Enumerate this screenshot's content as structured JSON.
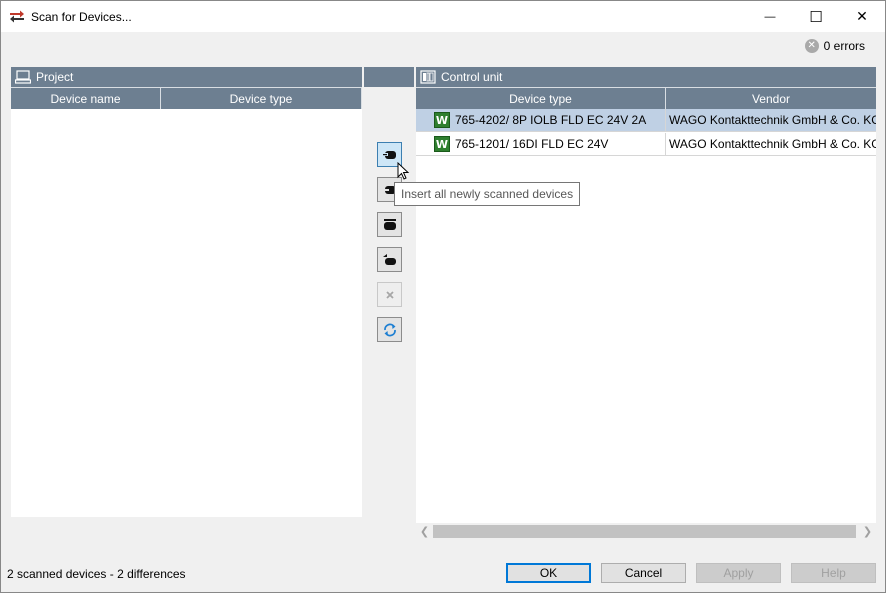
{
  "window": {
    "title": "Scan for Devices...",
    "minimize_glyph": "—",
    "maximize_glyph": "☐",
    "close_glyph": "✕"
  },
  "errors": {
    "icon": "error-circle-icon",
    "label": "0 errors"
  },
  "project_panel": {
    "title": "Project",
    "icon": "computer-icon",
    "columns": [
      "Device name",
      "Device type"
    ]
  },
  "control_panel": {
    "title": "Control unit",
    "icon": "control-unit-icon",
    "columns": [
      "Device type",
      "Vendor"
    ],
    "rows": [
      {
        "device_type": "765-4202/ 8P IOLB FLD EC 24V 2A",
        "vendor": "WAGO Kontakttechnik GmbH & Co. KG",
        "icon": "wago-icon",
        "selected": true
      },
      {
        "device_type": "765-1201/ 16DI FLD EC 24V",
        "vendor": "WAGO Kontakttechnik GmbH & Co. KG",
        "icon": "wago-icon",
        "selected": false
      }
    ]
  },
  "toolbar": {
    "buttons": [
      {
        "name": "insert-all-new-button",
        "icon": "insert-all-icon",
        "active": true
      },
      {
        "name": "insert-selected-button",
        "icon": "insert-icon"
      },
      {
        "name": "copy-all-button",
        "icon": "copy-all-icon"
      },
      {
        "name": "replace-button",
        "icon": "replace-icon"
      },
      {
        "name": "delete-button",
        "icon": "delete-icon",
        "disabled": true
      },
      {
        "name": "refresh-button",
        "icon": "refresh-icon"
      }
    ],
    "tooltip": "Insert all newly scanned devices"
  },
  "wago_glyph": "W",
  "status": "2 scanned devices - 2 differences",
  "buttons": {
    "ok": "OK",
    "cancel": "Cancel",
    "apply": "Apply",
    "help": "Help"
  },
  "colors": {
    "header_bg": "#6d7f91",
    "selected_row": "#bfd0e4",
    "wago_green": "#2f7f2f"
  }
}
